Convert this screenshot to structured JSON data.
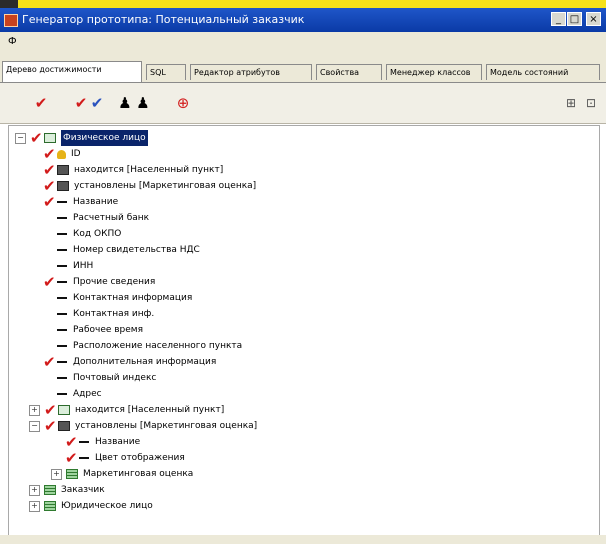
{
  "window": {
    "title": "Генератор прототипа: Потенциальный заказчик",
    "min": "_",
    "max": "□",
    "close": "×"
  },
  "menu": {
    "label": "Ф"
  },
  "tabs": [
    {
      "label": "Дерево достижимости"
    },
    {
      "label": "SQL"
    },
    {
      "label": "Редактор атрибутов"
    },
    {
      "label": "Свойства"
    },
    {
      "label": "Менеджер классов"
    },
    {
      "label": "Модель состояний"
    }
  ],
  "toolbar": {
    "check1": "✔",
    "check2": "✔",
    "check3": "✔",
    "person1": "♟",
    "person2": "♟",
    "symbol": "⊕",
    "right1": "⊞",
    "right2": "⊡"
  },
  "tree": {
    "root": "Физическое лицо",
    "n1": "ID",
    "n2": "находится [Населенный пункт]",
    "n3": "установлены [Маркетинговая оценка]",
    "n4": "Название",
    "n5": "Расчетный банк",
    "n6": "Код ОКПО",
    "n7": "Номер свидетельства НДС",
    "n8": "ИНН",
    "n9": "Прочие сведения",
    "n10": "Контактная информация",
    "n11": "Контактная инф.",
    "n12": "Рабочее время",
    "n13": "Расположение населенного пункта",
    "n14": "Дополнительная информация",
    "n15": "Почтовый индекс",
    "n16": "Адрес",
    "n17": "находится [Населенный пункт]",
    "n18": "установлены [Маркетинговая оценка]",
    "n19": "Название",
    "n20": "Цвет отображения",
    "n21": "Маркетинговая оценка",
    "n22": "Заказчик",
    "n23": "Юридическое лицо"
  }
}
